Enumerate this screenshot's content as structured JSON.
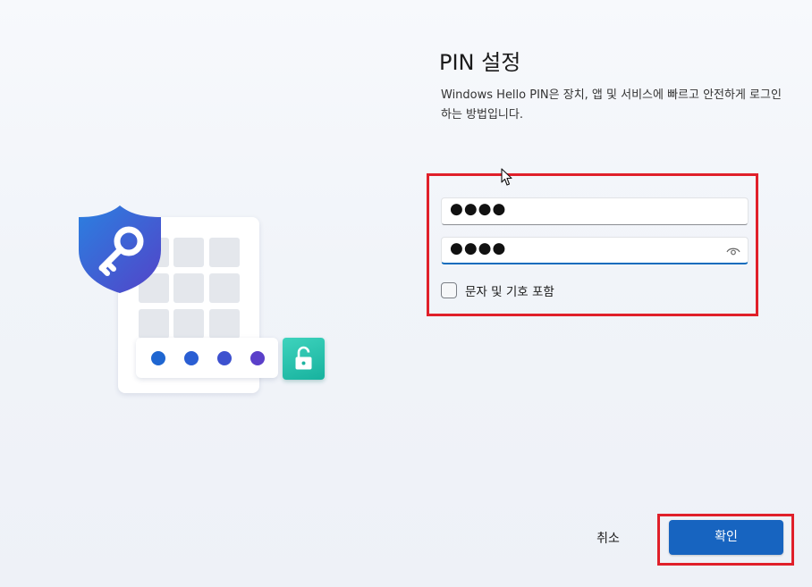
{
  "dialog": {
    "title": "PIN 설정",
    "description": "Windows Hello PIN은 장치, 앱 및 서비스에 빠르고 안전하게 로그인하는 방법입니다."
  },
  "form": {
    "new_pin_value": "●●●●",
    "confirm_pin_value": "●●●●",
    "include_chars_label": "문자 및 기호 포함",
    "include_chars_checked": false
  },
  "buttons": {
    "cancel_label": "취소",
    "ok_label": "확인"
  },
  "colors": {
    "accent": "#1764c0",
    "highlight": "#e0202a",
    "lock_tile": "#2cc4ad",
    "shield": "#2c6fd6"
  },
  "icons": {
    "shield": "shield-key-icon",
    "lock": "unlock-icon",
    "eye": "eye-icon",
    "cursor": "mouse-cursor-icon"
  }
}
